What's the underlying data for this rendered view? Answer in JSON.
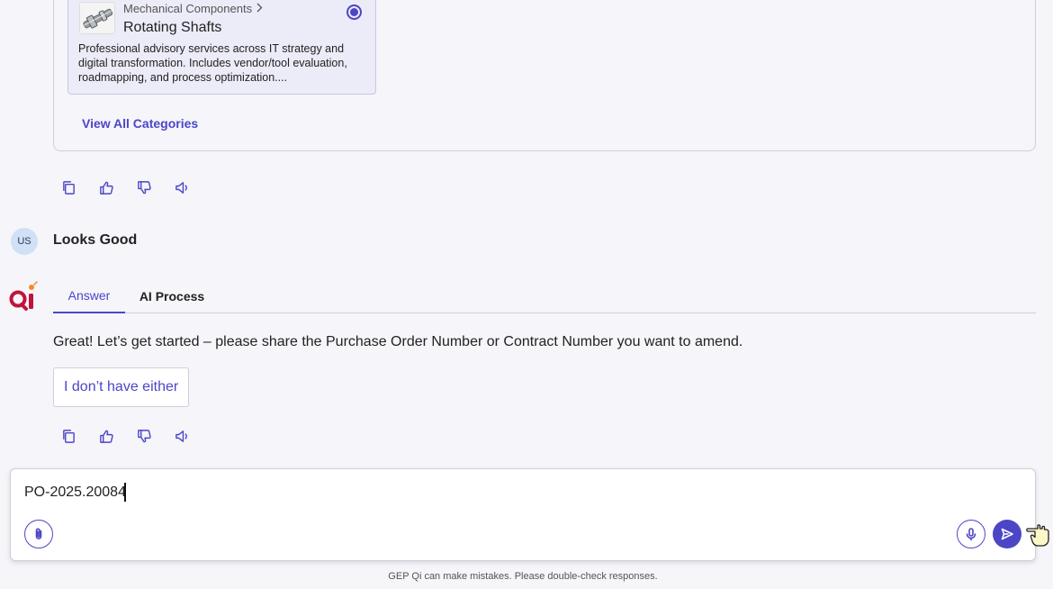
{
  "category_card": {
    "breadcrumb": "Mechanical Components",
    "title": "Rotating Shafts",
    "description": "Professional advisory services across IT strategy and digital transformation. Includes vendor/tool evaluation, roadmapping, and process optimization....",
    "selected": true
  },
  "view_all_label": "View All Categories",
  "actions": [
    "copy-icon",
    "thumbs-up-icon",
    "thumbs-down-icon",
    "speaker-icon"
  ],
  "user": {
    "initials": "US",
    "message": "Looks Good"
  },
  "tabs": [
    {
      "label": "Answer",
      "active": true
    },
    {
      "label": "AI Process",
      "active": false
    }
  ],
  "answer": {
    "text": "Great! Let’s get started – please share the Purchase Order Number or Contract Number you want to amend.",
    "suggestion": "I don’t have either"
  },
  "composer": {
    "value": "PO-2025.20084"
  },
  "disclaimer": "GEP Qi can make mistakes. Please double-check responses.",
  "colors": {
    "accent": "#4c46c6",
    "background": "#f5f5fa",
    "logo_red": "#c0143c"
  }
}
